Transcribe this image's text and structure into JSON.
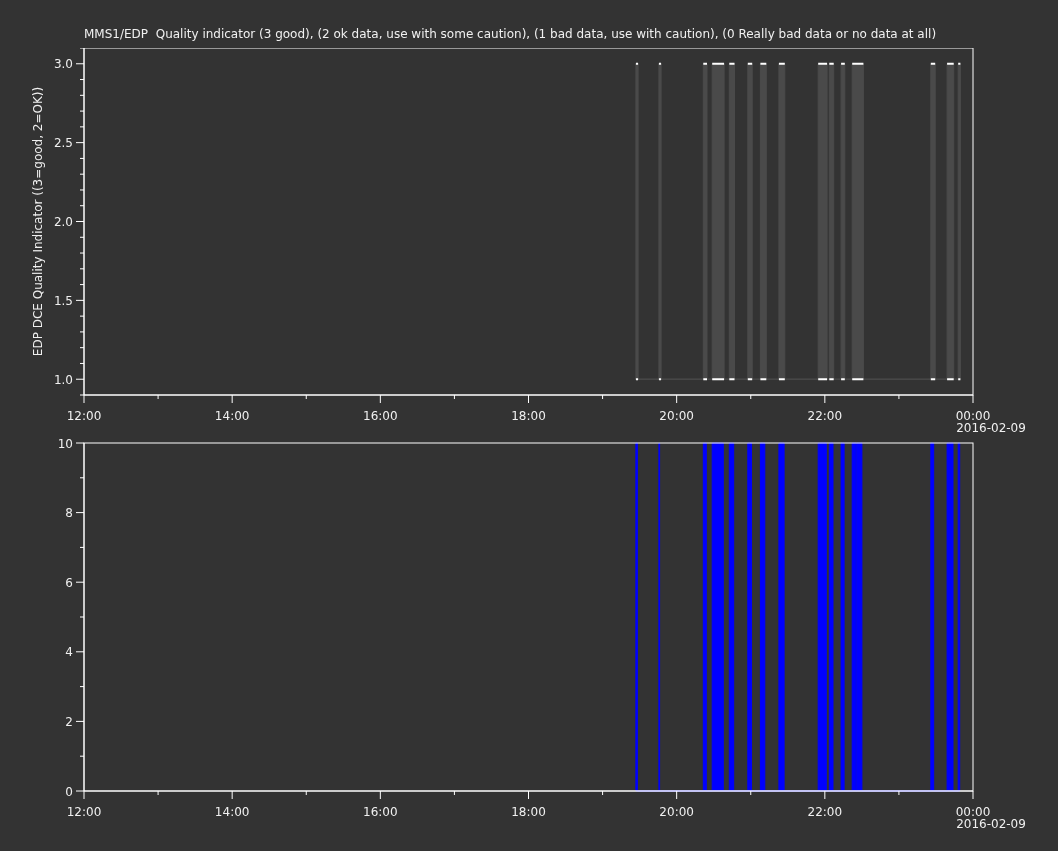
{
  "plots": [
    {
      "chart_data": {
        "type": "area",
        "title": "MMS1/EDP  Quality indicator (3 good), (2 ok data, use with some caution), (1 bad data, use with caution), (0 Really bad data or no data at all)",
        "ylabel": "EDP DCE Quality Indicator ((3=good, 2=OK))",
        "x": [
          19.45,
          19.45,
          19.48,
          19.48,
          19.76,
          19.76,
          19.79,
          19.79,
          20.36,
          20.36,
          20.41,
          20.41,
          20.48,
          20.48,
          20.64,
          20.64,
          20.71,
          20.71,
          20.78,
          20.78,
          20.96,
          20.96,
          21.02,
          21.02,
          21.13,
          21.13,
          21.21,
          21.21,
          21.38,
          21.38,
          21.46,
          21.46,
          21.91,
          21.91,
          22.03,
          22.03,
          22.06,
          22.06,
          22.12,
          22.12,
          22.22,
          22.22,
          22.27,
          22.27,
          22.37,
          22.37,
          22.52,
          22.52,
          23.43,
          23.43,
          23.49,
          23.49,
          23.65,
          23.65,
          23.74,
          23.74,
          23.8,
          23.8,
          23.83,
          23.83
        ],
        "series": [
          {
            "color": "#4a4a4a",
            "values": [
              1,
              3,
              3,
              1,
              1,
              3,
              3,
              1,
              1,
              3,
              3,
              1,
              1,
              3,
              3,
              1,
              1,
              3,
              3,
              1,
              1,
              3,
              3,
              1,
              1,
              3,
              3,
              1,
              1,
              3,
              3,
              1,
              1,
              3,
              3,
              1,
              1,
              3,
              3,
              1,
              1,
              3,
              3,
              1,
              1,
              3,
              3,
              1,
              1,
              3,
              3,
              1,
              1,
              3,
              3,
              1,
              1,
              3,
              3,
              1
            ]
          }
        ],
        "xlim": [
          12,
          24
        ],
        "ylim": [
          0.9,
          3.1
        ],
        "xticks": [
          {
            "value": 12,
            "label": "12:00"
          },
          {
            "value": 14,
            "label": "14:00"
          },
          {
            "value": 16,
            "label": "16:00"
          },
          {
            "value": 18,
            "label": "18:00"
          },
          {
            "value": 20,
            "label": "20:00"
          },
          {
            "value": 22,
            "label": "22:00"
          },
          {
            "value": 24,
            "label": "00:00"
          }
        ],
        "yticks": [
          {
            "value": 1,
            "label": "1.0"
          },
          {
            "value": 1.5,
            "label": "1.5"
          },
          {
            "value": 2,
            "label": "2.0"
          },
          {
            "value": 2.5,
            "label": "2.5"
          },
          {
            "value": 3,
            "label": "3.0"
          }
        ]
      },
      "date_label": "2016-02-09"
    },
    {
      "chart_data": {
        "type": "area",
        "x": [
          19.45,
          19.45,
          19.47,
          19.47,
          19.76,
          19.76,
          19.77,
          19.77,
          20.36,
          20.36,
          20.4,
          20.4,
          20.48,
          20.48,
          20.63,
          20.63,
          20.71,
          20.71,
          20.77,
          20.77,
          20.96,
          20.96,
          21.01,
          21.01,
          21.13,
          21.13,
          21.19,
          21.19,
          21.38,
          21.38,
          21.45,
          21.45,
          21.91,
          21.91,
          22.02,
          22.02,
          22.06,
          22.06,
          22.11,
          22.11,
          22.22,
          22.22,
          22.26,
          22.26,
          22.37,
          22.37,
          22.42,
          22.42,
          22.43,
          22.43,
          22.5,
          22.5,
          23.43,
          23.43,
          23.47,
          23.47,
          23.65,
          23.65,
          23.73,
          23.73,
          23.8,
          23.8,
          23.82,
          23.82
        ],
        "series": [
          {
            "color": "#0000ff",
            "values": [
              0,
              10,
              10,
              0,
              0,
              10,
              10,
              0,
              0,
              10,
              10,
              0,
              0,
              10,
              10,
              0,
              0,
              10,
              10,
              0,
              0,
              10,
              10,
              0,
              0,
              10,
              10,
              0,
              0,
              10,
              10,
              0,
              0,
              10,
              10,
              0,
              0,
              10,
              10,
              0,
              0,
              10,
              10,
              0,
              0,
              10,
              10,
              0,
              0,
              10,
              10,
              0,
              0,
              10,
              10,
              0,
              0,
              10,
              10,
              0,
              0,
              10,
              10,
              0
            ]
          }
        ],
        "xlim": [
          12,
          24
        ],
        "ylim": [
          0,
          10
        ],
        "xticks": [
          {
            "value": 12,
            "label": "12:00"
          },
          {
            "value": 14,
            "label": "14:00"
          },
          {
            "value": 16,
            "label": "16:00"
          },
          {
            "value": 18,
            "label": "18:00"
          },
          {
            "value": 20,
            "label": "20:00"
          },
          {
            "value": 22,
            "label": "22:00"
          },
          {
            "value": 24,
            "label": "00:00"
          }
        ],
        "yticks": [
          0,
          2,
          4,
          6,
          8,
          10
        ]
      },
      "date_label": "2016-02-09"
    }
  ]
}
